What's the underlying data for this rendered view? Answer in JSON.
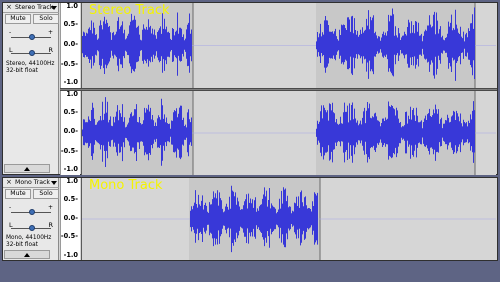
{
  "tracks": {
    "stereo": {
      "name": "Stereo Track",
      "label": "Stereo Track",
      "mute_label": "Mute",
      "solo_label": "Solo",
      "gain_minus": "-",
      "gain_plus": "+",
      "pan_left": "L",
      "pan_right": "R",
      "info_line1": "Stereo, 44100Hz",
      "info_line2": "32-bit float",
      "ruler_ticks": [
        "1.0",
        "0.5-",
        "0.0-",
        "-0.5-",
        "-1.0"
      ]
    },
    "mono": {
      "name": "Mono Track",
      "label": "Mono Track",
      "mute_label": "Mute",
      "solo_label": "Solo",
      "gain_minus": "-",
      "gain_plus": "+",
      "pan_left": "L",
      "pan_right": "R",
      "info_line1": "Mono, 44100Hz",
      "info_line2": "32-bit float",
      "ruler_ticks": [
        "1.0",
        "0.5-",
        "0.0-",
        "-0.5-",
        "-1.0"
      ]
    }
  },
  "colors": {
    "waveform": "#3838d8",
    "clip": "#c8c8c8",
    "background": "#d6d6d6",
    "track_label": "#f4f400",
    "desktop": "#5e6484"
  }
}
